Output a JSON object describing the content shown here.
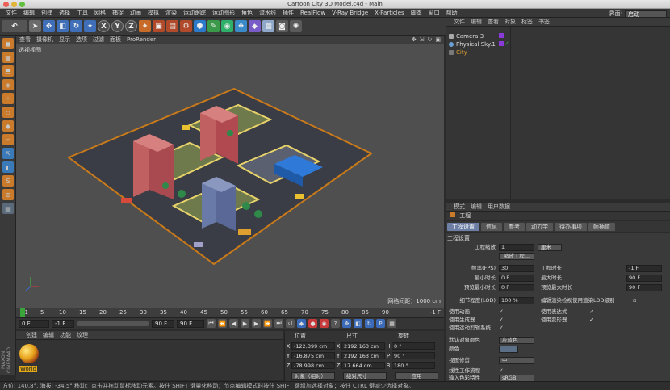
{
  "window": {
    "title": "Cartoon City 3D Model.c4d - Main"
  },
  "menubar": {
    "items": [
      "文件",
      "编辑",
      "创建",
      "选择",
      "工具",
      "网格",
      "捕捉",
      "动画",
      "模拟",
      "渲染",
      "运动跟踪",
      "运动图形",
      "角色",
      "流水线",
      "插件",
      "RealFlow",
      "V-Ray Bridge",
      "X-Particles",
      "脚本",
      "窗口",
      "帮助"
    ],
    "layout_label": "界面:",
    "layout_value": "启动"
  },
  "toolbar": {
    "axis_x": "X",
    "axis_y": "Y",
    "axis_z": "Z"
  },
  "viewport": {
    "menu": [
      "查看",
      "摄像机",
      "显示",
      "选项",
      "过滤",
      "面板",
      "ProRender"
    ],
    "label": "透视视图",
    "grid_distance": "网格间距：1000 cm"
  },
  "timeline": {
    "ticks": [
      "-1",
      "5",
      "10",
      "15",
      "20",
      "25",
      "30",
      "35",
      "40",
      "45",
      "50",
      "55",
      "60",
      "65",
      "70",
      "75",
      "80",
      "85",
      "90"
    ],
    "end_field": "-1 F"
  },
  "transport": {
    "current": "0 F",
    "min": "-1 F",
    "max": "90 F",
    "range_end": "90 F"
  },
  "material_panel": {
    "menu": [
      "创建",
      "编辑",
      "功能",
      "纹理"
    ],
    "material_name": "World",
    "brand": "MAXON CINEMA4D"
  },
  "coordinates": {
    "headers": {
      "position": "位置",
      "size": "尺寸",
      "rotation": "旋转"
    },
    "rows": [
      {
        "axis": "X",
        "pos": "-122.399 cm",
        "size_axis": "X",
        "size": "2192.163 cm",
        "rot_axis": "H",
        "rot": "0 °"
      },
      {
        "axis": "Y",
        "pos": "-16.875 cm",
        "size_axis": "Y",
        "size": "2192.163 cm",
        "rot_axis": "P",
        "rot": "90 °"
      },
      {
        "axis": "Z",
        "pos": "-78.998 cm",
        "size_axis": "Z",
        "size": "17.664 cm",
        "rot_axis": "B",
        "rot": "180 °"
      }
    ],
    "mode_dropdown": "对象（相对）",
    "size_dropdown": "绝对尺寸",
    "apply_button": "应用"
  },
  "object_manager": {
    "menu": [
      "文件",
      "编辑",
      "查看",
      "对象",
      "标签",
      "书签"
    ],
    "objects": [
      {
        "name": "Camera.3",
        "color": "#cfcfcf"
      },
      {
        "name": "Physical Sky.1",
        "color": "#cfcfcf"
      },
      {
        "name": "City",
        "color": "#e0a030"
      }
    ]
  },
  "attribute_manager": {
    "menu": [
      "模式",
      "编辑",
      "用户数据"
    ],
    "title": "工程",
    "tabs": [
      "工程设置",
      "信息",
      "参考",
      "动力学",
      "待办事项",
      "帧插值"
    ],
    "section": "工程设置",
    "project_scale_label": "工程缩放",
    "project_scale_value": "1",
    "project_scale_unit": "厘米",
    "scale_button": "缩放工程...",
    "fps_label": "帧率(FPS)",
    "fps_value": "30",
    "project_length_label": "工程时长",
    "project_length_value": "-1 F",
    "min_time_label": "最小时长",
    "min_time_value": "0 F",
    "max_time_label": "最大时长",
    "max_time_value": "90 F",
    "preview_min_label": "预览最小时长",
    "preview_min_value": "0 F",
    "preview_max_label": "预览最大时长",
    "preview_max_value": "90 F",
    "lod_label": "细节程度(LOD)",
    "lod_value": "100 %",
    "lod_render_label": "编辑渲染检视使用渲染LOD级别",
    "use_animation_label": "使用动画",
    "use_expression_label": "使用表达式",
    "use_generator_label": "使用生成器",
    "use_deformer_label": "使用变形器",
    "use_motion_label": "使用运动剪辑系统",
    "default_color_label": "默认对象颜色",
    "default_color_value": "灰蓝色",
    "color_label": "颜色",
    "view_clip_label": "视图修剪",
    "view_clip_value": "中",
    "linear_workflow_label": "线性工作流程",
    "input_color_label": "输入色彩特性",
    "input_color_value": "sRGB"
  },
  "status": {
    "text": "方位: 140.8°, 海拔: -34.5°  移动：点击并拖动鼠标移动元素。按住 SHIFT 键量化移动；节点编辑模式时按住 SHIFT 键增加选择对象；按住 CTRL 键减少选择对象。"
  }
}
